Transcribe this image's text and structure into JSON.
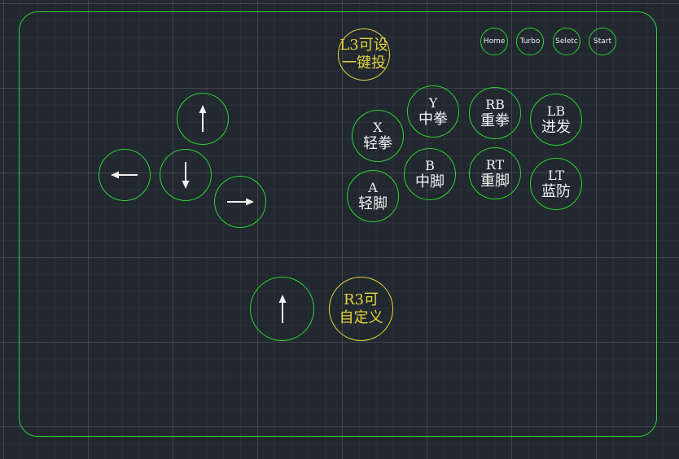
{
  "colors": {
    "background": "#212830",
    "outline": "#2fd12f",
    "highlight": "#e5d23a",
    "label": "#f2f2f2"
  },
  "system_buttons": {
    "home": "Home",
    "turbo": "Turbo",
    "select": "Seletc",
    "start": "Start"
  },
  "special_buttons": {
    "l3": {
      "line1": "L3可设",
      "line2": "一键投"
    },
    "r3": {
      "line1": "R3可",
      "line2": "自定义"
    }
  },
  "dpad": {
    "up_icon": "arrow-up-icon",
    "left_icon": "arrow-left-icon",
    "down_icon": "arrow-down-icon",
    "right_icon": "arrow-right-icon",
    "extra_up_icon": "arrow-up-icon"
  },
  "face_buttons": {
    "x": {
      "key": "X",
      "action": "轻拳"
    },
    "y": {
      "key": "Y",
      "action": "中拳"
    },
    "rb": {
      "key": "RB",
      "action": "重拳"
    },
    "lb": {
      "key": "LB",
      "action": "进发"
    },
    "a": {
      "key": "A",
      "action": "轻脚"
    },
    "b": {
      "key": "B",
      "action": "中脚"
    },
    "rt": {
      "key": "RT",
      "action": "重脚"
    },
    "lt": {
      "key": "LT",
      "action": "蓝防"
    }
  }
}
